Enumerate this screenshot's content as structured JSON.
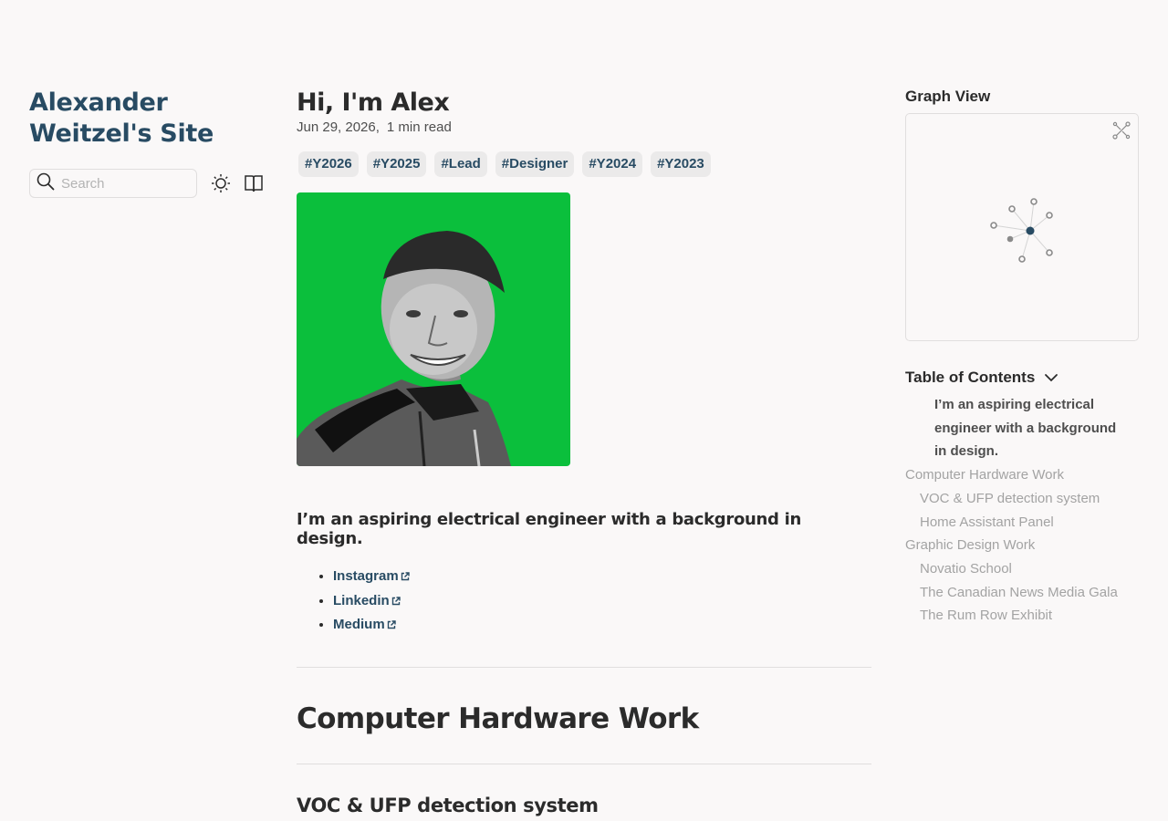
{
  "site": {
    "title": "Alexander Weitzel's Site"
  },
  "search": {
    "placeholder": "Search"
  },
  "page": {
    "title": "Hi, I'm Alex",
    "date": "Jun 29, 2026,",
    "read_time": "1 min read",
    "tags": [
      "#Y2026",
      "#Y2025",
      "#Lead",
      "#Designer",
      "#Y2024",
      "#Y2023"
    ],
    "intro": "I’m an aspiring electrical engineer with a background in design.",
    "links": [
      "Instagram",
      "Linkedin",
      "Medium"
    ],
    "h1": "Computer Hardware Work",
    "h2": "VOC & UFP detection system"
  },
  "graph": {
    "title": "Graph View"
  },
  "toc": {
    "title": "Table of Contents",
    "items": [
      {
        "label": "I’m an aspiring electrical engineer with a background in design.",
        "depth": 3
      },
      {
        "label": "Computer Hardware Work",
        "depth": 1
      },
      {
        "label": "VOC & UFP detection system",
        "depth": 2
      },
      {
        "label": "Home Assistant Panel",
        "depth": 2
      },
      {
        "label": "Graphic Design Work",
        "depth": 1
      },
      {
        "label": "Novatio School",
        "depth": 2
      },
      {
        "label": "The Canadian News Media Gala",
        "depth": 2
      },
      {
        "label": "The Rum Row Exhibit",
        "depth": 2
      }
    ]
  },
  "colors": {
    "accent": "#284b63",
    "portrait_bg": "#0bbf3c",
    "muted": "#a3a3a3"
  }
}
